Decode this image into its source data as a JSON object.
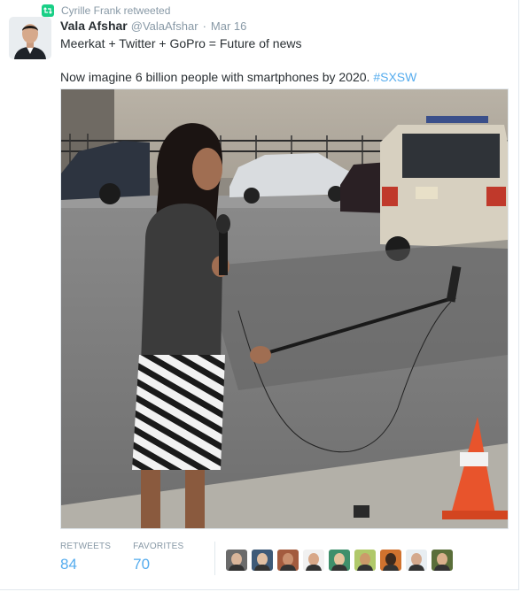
{
  "retweet_context": {
    "icon": "retweet-icon",
    "text": "Cyrille Frank retweeted"
  },
  "author": {
    "fullname": "Vala Afshar",
    "handle": "@ValaAfshar",
    "separator": "·",
    "date": "Mar 16"
  },
  "tweet": {
    "line1": "Meerkat + Twitter + GoPro = Future of news",
    "line2_text": "Now imagine 6 billion people with smartphones by 2020. ",
    "hashtag": "#SXSW"
  },
  "stats": {
    "retweets_label": "RETWEETS",
    "retweets_count": "84",
    "favorites_label": "FAVORITES",
    "favorites_count": "70"
  },
  "favoriters": [
    {
      "color": "#6b6b6b",
      "skin": "#d9b59a"
    },
    {
      "color": "#3e5a78",
      "skin": "#e0bfa3"
    },
    {
      "color": "#a35b3e",
      "skin": "#c98f6e"
    },
    {
      "color": "#f1f1f1",
      "skin": "#d8a889"
    },
    {
      "color": "#3f8f6b",
      "skin": "#e6c39d"
    },
    {
      "color": "#b0c96a",
      "skin": "#cc9a6a"
    },
    {
      "color": "#d0722e",
      "skin": "#3d2a1e"
    },
    {
      "color": "#e8eef2",
      "skin": "#d4a98d"
    },
    {
      "color": "#5a6e3a",
      "skin": "#d9b08c"
    }
  ],
  "colors": {
    "accent": "#55acee",
    "retweet_green": "#19cf86",
    "muted": "#8899a6",
    "text": "#292f33"
  }
}
